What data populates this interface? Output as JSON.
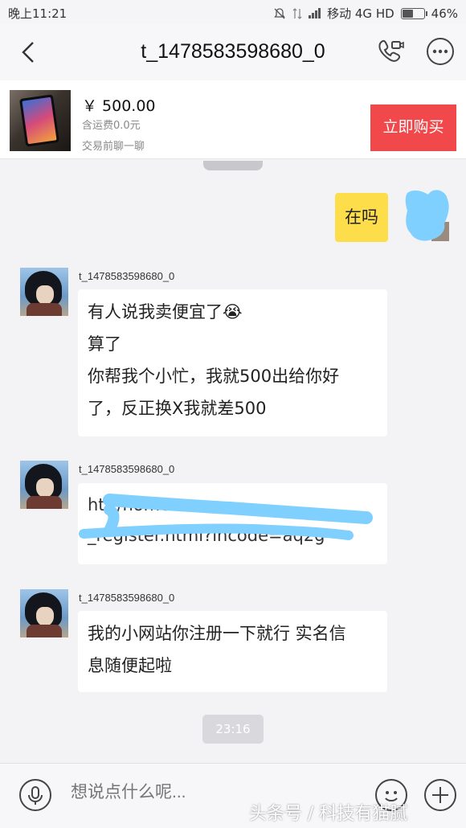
{
  "status": {
    "time": "晚上11:21",
    "carrier": "移动 4G HD",
    "battery": "46%",
    "battery_level": 0.46
  },
  "header": {
    "title": "t_1478583598680_0"
  },
  "product": {
    "price": "￥ 500.00",
    "shipping": "含运费0.0元",
    "chat_note": "交易前聊一聊",
    "buy_label": "立即购买"
  },
  "messages": [
    {
      "sender": "t_1478583598680_0",
      "lines": [
        "有人说我卖便宜了😭",
        "算了",
        "你帮我个小忙，我就500出给你好",
        "了，反正换X我就差500"
      ]
    },
    {
      "sender": "t_1478583598680_0",
      "lines": [
        "htt                                  /home",
        "_register.html?incode=aq2g"
      ]
    },
    {
      "sender": "t_1478583598680_0",
      "lines": [
        "我的小网站你注册一下就行 实名信",
        "息随便起啦"
      ]
    }
  ],
  "my_message": "在吗",
  "timestamp": "23:16",
  "input": {
    "placeholder": "想说点什么呢..."
  },
  "watermark": "头条号 / 科技有猫腻",
  "icons": {
    "back": "chevron-left-icon",
    "call": "phone-video-icon",
    "more": "more-dots-icon",
    "voice": "microphone-icon",
    "emoji": "smile-icon",
    "add": "plus-icon"
  }
}
